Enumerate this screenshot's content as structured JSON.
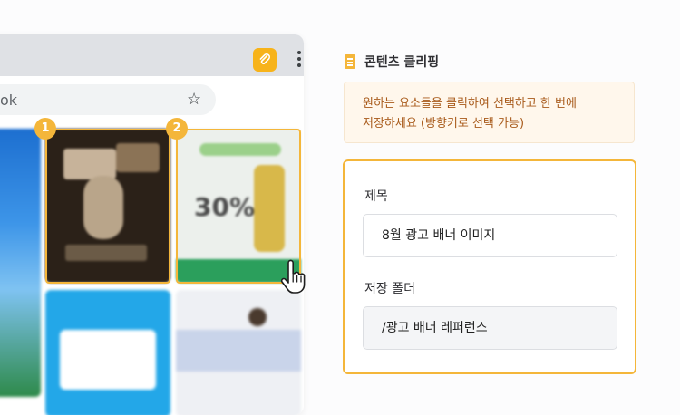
{
  "browser": {
    "address_text": "ok",
    "star_icon": "star-icon",
    "extension_icon": "paperclip-icon",
    "menu_icon": "kebab-menu-icon",
    "selection_badges": [
      "1",
      "2"
    ]
  },
  "panel": {
    "title": "콘텐츠 클리핑",
    "info_line1": "원하는 요소들을 클릭하여 선택하고 한 번에",
    "info_line2": "저장하세요 (방향키로 선택 가능)",
    "form": {
      "title_label": "제목",
      "title_value": "8월 광고 배너 이미지",
      "folder_label": "저장 폴더",
      "folder_value": "/광고 배너 레퍼런스"
    }
  },
  "colors": {
    "accent": "#f4b63a",
    "info_bg": "#fff7ec",
    "info_text": "#a85a1a"
  }
}
